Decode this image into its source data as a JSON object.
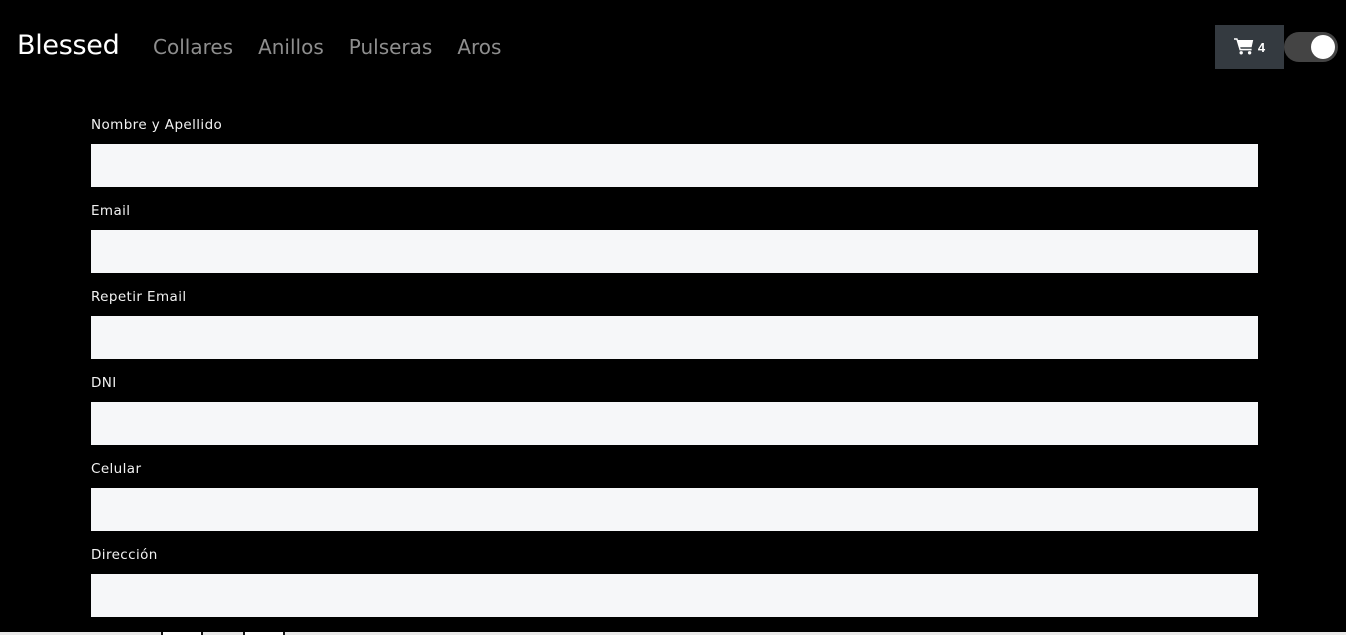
{
  "navbar": {
    "brand": "Blessed",
    "links": [
      {
        "label": "Collares"
      },
      {
        "label": "Anillos"
      },
      {
        "label": "Pulseras"
      },
      {
        "label": "Aros"
      }
    ],
    "cart": {
      "icon": "shopping-cart-icon",
      "count": "4"
    },
    "theme_toggle": {
      "state": "on"
    }
  },
  "form": {
    "fields": [
      {
        "label": "Nombre y Apellido",
        "value": ""
      },
      {
        "label": "Email",
        "value": ""
      },
      {
        "label": "Repetir Email",
        "value": ""
      },
      {
        "label": "DNI",
        "value": ""
      },
      {
        "label": "Celular",
        "value": ""
      },
      {
        "label": "Dirección",
        "value": ""
      }
    ]
  },
  "colors": {
    "background": "#000000",
    "input_bg": "#f6f7f9",
    "nav_link": "#8e8e8e",
    "cart_button_bg": "#343a40"
  }
}
